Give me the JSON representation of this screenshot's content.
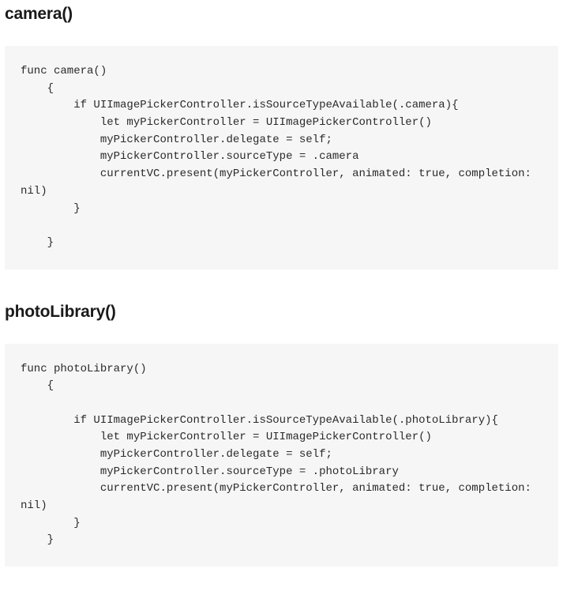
{
  "sections": [
    {
      "heading": "camera()",
      "code": "func camera()\n    {\n        if UIImagePickerController.isSourceTypeAvailable(.camera){\n            let myPickerController = UIImagePickerController()\n            myPickerController.delegate = self;\n            myPickerController.sourceType = .camera\n            currentVC.present(myPickerController, animated: true, completion: nil)\n        }\n\n    }"
    },
    {
      "heading": "photoLibrary()",
      "code": "func photoLibrary()\n    {\n\n        if UIImagePickerController.isSourceTypeAvailable(.photoLibrary){\n            let myPickerController = UIImagePickerController()\n            myPickerController.delegate = self;\n            myPickerController.sourceType = .photoLibrary\n            currentVC.present(myPickerController, animated: true, completion: nil)\n        }\n    }"
    }
  ]
}
